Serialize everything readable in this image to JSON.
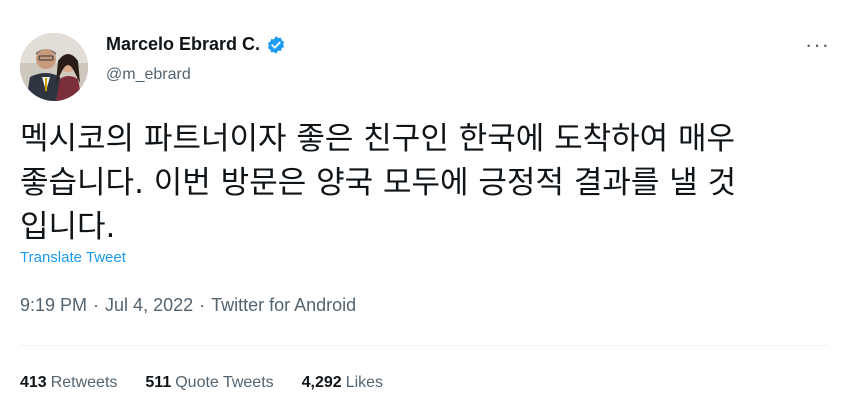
{
  "author": {
    "display_name": "Marcelo Ebrard C.",
    "handle": "@m_ebrard",
    "verified_icon": "verified-badge-icon",
    "accent_color": "#1d9bf0"
  },
  "more_icon": "more-horizontal-icon",
  "tweet": {
    "text": "멕시코의 파트너이자 좋은 친구인 한국에 도착하여 매우\n좋습니다. 이번 방문은 양국 모두에 긍정적 결과를 낼 것\n입니다."
  },
  "translate_label": "Translate Tweet",
  "meta": {
    "time": "9:19 PM",
    "separator": "·",
    "date": "Jul 4, 2022",
    "source": "Twitter for Android"
  },
  "stats": {
    "retweets_count": "413",
    "retweets_label": "Retweets",
    "quote_count": "511",
    "quote_label": "Quote Tweets",
    "likes_count": "4,292",
    "likes_label": "Likes"
  }
}
